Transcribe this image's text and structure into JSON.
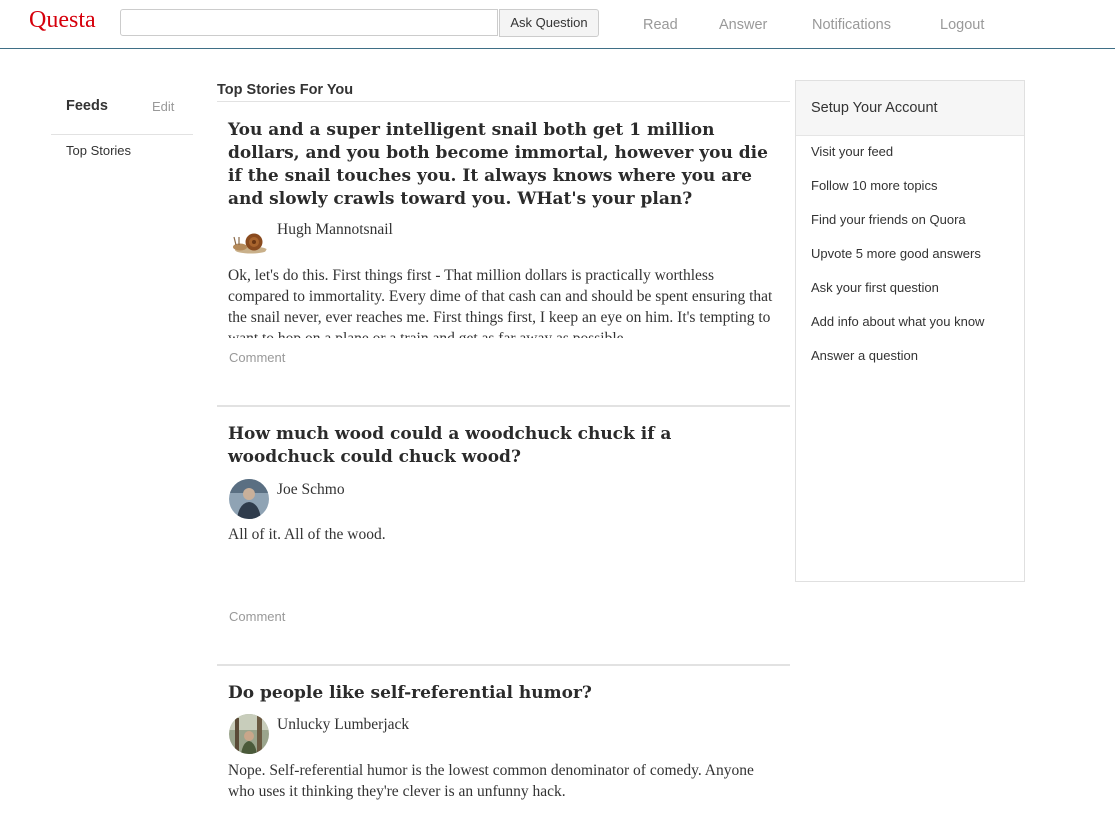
{
  "nav": {
    "logo": "Questa",
    "search_placeholder": "",
    "ask_label": "Ask Question",
    "links": [
      "Read",
      "Answer",
      "Notifications",
      "Logout"
    ]
  },
  "sidebar": {
    "title": "Feeds",
    "edit_label": "Edit",
    "items": [
      {
        "label": "Top Stories"
      }
    ]
  },
  "main": {
    "section_title": "Top Stories For You",
    "stories": [
      {
        "question": "You and a super intelligent snail both get 1 million dollars, and you both become immortal, however you die if the snail touches you. It always knows where you are and slowly crawls toward you. WHat's your plan?",
        "author": "Hugh Mannotsnail",
        "answer": "Ok, let's do this. First things first - That million dollars is practically worthless compared to immortality. Every dime of that cash can and should be spent ensuring that the snail never, ever reaches me. First things first, I keep an eye on him. It's tempting to want to hop on a plane or a train and get as far away as possible.",
        "comment_label": "Comment"
      },
      {
        "question": "How much wood could a woodchuck chuck if a woodchuck could chuck wood?",
        "author": "Joe Schmo",
        "answer": "All of it. All of the wood.",
        "comment_label": "Comment"
      },
      {
        "question": "Do people like self-referential humor?",
        "author": "Unlucky Lumberjack",
        "answer": "Nope. Self-referential humor is the lowest common denominator of comedy. Anyone who uses it thinking they're clever is an unfunny hack."
      }
    ]
  },
  "setup": {
    "title": "Setup Your Account",
    "items": [
      "Visit your feed",
      "Follow 10 more topics",
      "Find your friends on Quora",
      "Upvote 5 more good answers",
      "Ask your first question",
      "Add info about what you know",
      "Answer a question"
    ]
  }
}
